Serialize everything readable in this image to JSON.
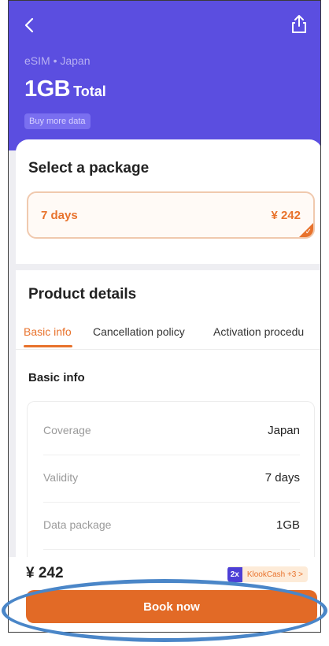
{
  "header": {
    "breadcrumb": "eSIM • Japan",
    "data_amount": "1GB",
    "data_suffix": "Total",
    "buy_more_label": "Buy more data",
    "background_color": "#5b4ee0"
  },
  "package": {
    "title": "Select a package",
    "selected": {
      "days": "7 days",
      "price": "¥ 242"
    }
  },
  "details": {
    "title": "Product details",
    "tabs": [
      {
        "label": "Basic info",
        "active": true
      },
      {
        "label": "Cancellation policy",
        "active": false
      },
      {
        "label": "Activation procedu",
        "active": false
      }
    ],
    "basic_heading": "Basic info",
    "rows": [
      {
        "key": "Coverage",
        "value": "Japan"
      },
      {
        "key": "Validity",
        "value": "7 days"
      },
      {
        "key": "Data package",
        "value": "1GB"
      }
    ]
  },
  "footer": {
    "price": "¥ 242",
    "klook_multiplier": "2x",
    "klook_label": "KlookCash +3 >",
    "book_label": "Book now",
    "accent_color": "#e8722c"
  },
  "icons": {
    "back": "chevron-left-icon",
    "share": "share-icon"
  }
}
